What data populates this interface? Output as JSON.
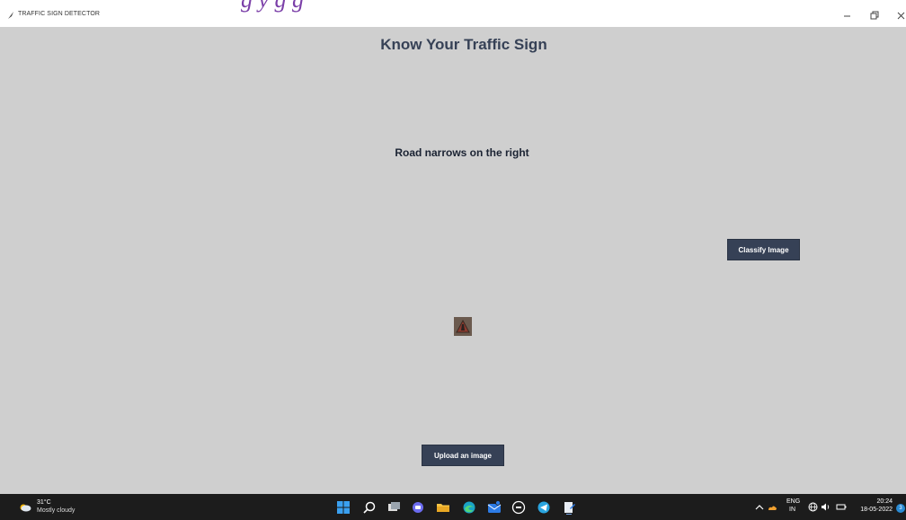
{
  "window": {
    "title": "TRAFFIC SIGN DETECTOR",
    "overlay_text": "g     y   g   g"
  },
  "app": {
    "heading": "Know Your Traffic Sign",
    "prediction": "Road narrows on the right",
    "classify_label": "Classify Image",
    "upload_label": "Upload an image"
  },
  "taskbar": {
    "weather_temp": "31°C",
    "weather_desc": "Mostly cloudy",
    "lang_top": "ENG",
    "lang_bottom": "IN",
    "time": "20:24",
    "date": "18-05-2022",
    "notification_count": "3",
    "pinned_icons": [
      "windows-start-icon",
      "search-icon",
      "task-view-icon",
      "chat-icon",
      "file-explorer-icon",
      "edge-icon",
      "mail-icon",
      "dell-icon",
      "telegram-icon",
      "notepad-icon"
    ]
  },
  "colors": {
    "canvas_bg": "#cfcfcf",
    "button_bg": "#364156",
    "heading": "#364156",
    "taskbar_bg": "#1c1c1c",
    "overlay_text": "#7b3fa8"
  }
}
